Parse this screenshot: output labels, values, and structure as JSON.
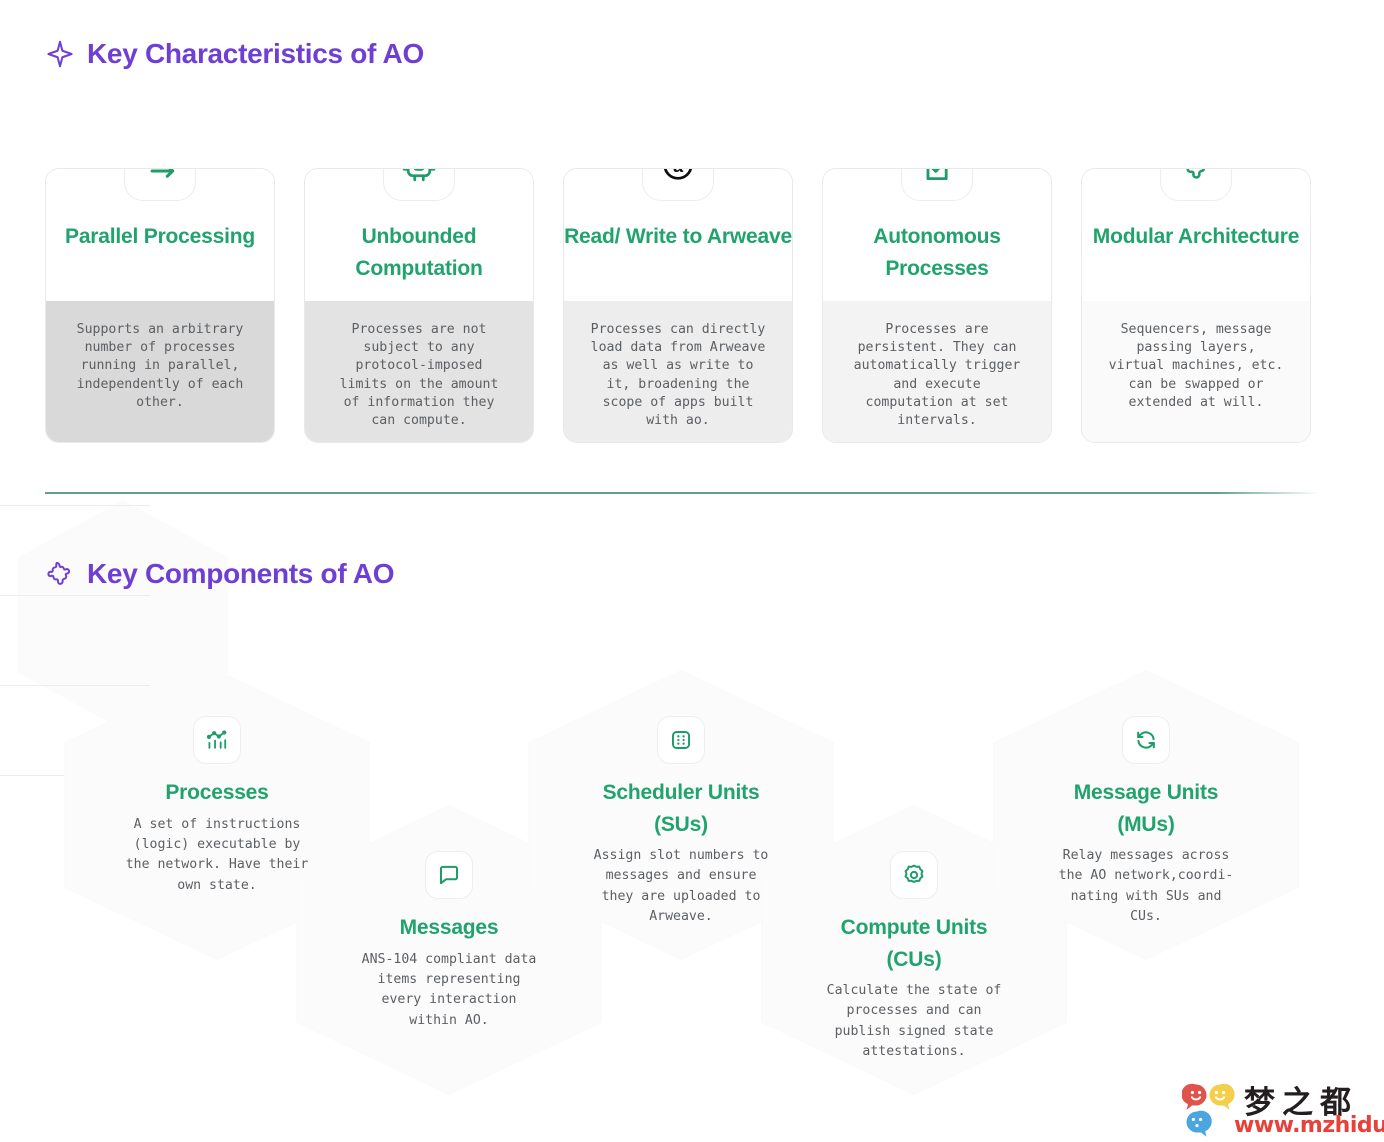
{
  "theme": {
    "heading_color": "#6f3fd4",
    "accent_green": "#21a36d",
    "divider_color": "#5fa08e",
    "body_text_color": "#5b5f63",
    "watermark_red": "#e8413a"
  },
  "sections": {
    "characteristics": {
      "heading": "Key Characteristics of AO",
      "heading_icon": "sparkle-icon",
      "cards": [
        {
          "icon": "arrows-parallel-icon",
          "title": "Parallel\nProcessing",
          "desc": "Supports an arbitrary\nnumber of processes\nrunning in parallel,\nindependently of each\nother.",
          "body_fill": "#d9d9d9"
        },
        {
          "icon": "cpu-chip-icon",
          "title": "Unbounded\nComputation",
          "desc": "Processes are not\nsubject to any\nprotocol-imposed\nlimits on the amount\nof information they\ncan compute.",
          "body_fill": "#e3e3e3"
        },
        {
          "icon": "arweave-a-icon",
          "title": "Read/ Write\nto Arweave",
          "desc": "Processes can directly\nload data from Arweave\nas well as write to\nit, broadening the\nscope of apps built\nwith ao.",
          "body_fill": "#ededed"
        },
        {
          "icon": "document-check-icon",
          "title": "Autonomous\nProcesses",
          "desc": "Processes are\npersistent. They can\nautomatically trigger\nand execute\ncomputation at set\nintervals.",
          "body_fill": "#f3f3f3"
        },
        {
          "icon": "puzzle-piece-icon",
          "title": "Modular\nArchitecture",
          "desc": "Sequencers, message\npassing layers,\nvirtual machines, etc.\ncan be swapped or\nextended at will.",
          "body_fill": "#fafafa"
        }
      ]
    },
    "components": {
      "heading": "Key Components of AO",
      "heading_icon": "puzzle-piece-icon",
      "hexes": [
        {
          "icon": "analytics-chart-icon",
          "title": "Processes",
          "desc": "A set of instructions\n(logic) executable by\nthe network. Have their\nown state."
        },
        {
          "icon": "chat-bubble-icon",
          "title": "Messages",
          "desc": "ANS-104 compliant data\nitems representing\nevery interaction\nwithin AO."
        },
        {
          "icon": "dice-dots-icon",
          "title": "Scheduler Units\n(SUs)",
          "desc": "Assign slot numbers to\nmessages and ensure\nthey are uploaded to\nArweave."
        },
        {
          "icon": "gear-cog-icon",
          "title": "Compute Units\n(CUs)",
          "desc": "Calculate the state of\nprocesses and can\npublish signed state\nattestations."
        },
        {
          "icon": "refresh-sync-icon",
          "title": "Message Units\n(MUs)",
          "desc": "Relay messages across\nthe AO network,coordi-\nnating with SUs and\nCUs."
        }
      ]
    }
  },
  "watermark": {
    "brand_cn": "梦之都",
    "url": "www.mzhidu.com"
  }
}
